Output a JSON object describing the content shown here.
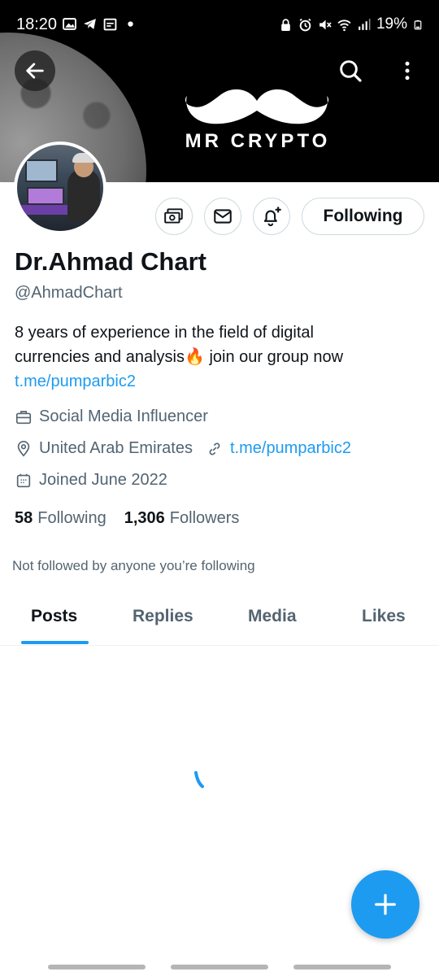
{
  "status_bar": {
    "time": "18:20",
    "battery": "19%"
  },
  "banner": {
    "brand_text": "MR CRYPTO"
  },
  "profile": {
    "name": "Dr.Ahmad Chart",
    "handle": "@AhmadChart",
    "bio_line1": "8 years of experience in the field of digital",
    "bio_line2_text": "currencies and analysis",
    "bio_line2_emoji": "🔥",
    "bio_line2_rest": " join our group now",
    "bio_link": "t.me/pumparbic2",
    "category": "Social Media Influencer",
    "location": "United Arab Emirates",
    "website": "t.me/pumparbic2",
    "joined": "Joined June 2022",
    "following_count": "58",
    "following_label": "Following",
    "followers_count": "1,306",
    "followers_label": "Followers",
    "not_followed_text": "Not followed by anyone you’re following"
  },
  "actions": {
    "following_button": "Following"
  },
  "tabs": [
    {
      "label": "Posts",
      "active": true
    },
    {
      "label": "Replies",
      "active": false
    },
    {
      "label": "Media",
      "active": false
    },
    {
      "label": "Likes",
      "active": false
    }
  ],
  "colors": {
    "accent": "#1d9bf0",
    "secondary_text": "#536471",
    "primary_text": "#0f1419"
  }
}
